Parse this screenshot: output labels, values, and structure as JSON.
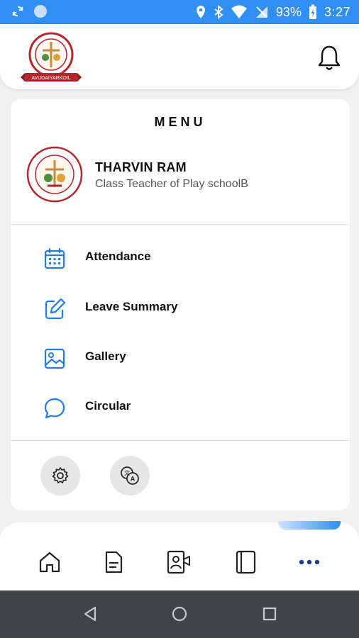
{
  "status_bar": {
    "battery": "93%",
    "time": "3:27"
  },
  "header": {
    "logo": {
      "ribbon_text": "AVUDAIYARKOIL",
      "ring_text": "ST. JOSEPH'S MATRIC HR SEC SCHOOL"
    }
  },
  "menu": {
    "title": "MENU",
    "profile": {
      "name": "THARVIN RAM",
      "role": "Class Teacher of Play schoolB",
      "logo_ring_text": "ST. JOSEPH'S MATRIC HR SEC SCHOOL",
      "logo_bottom_text": "AVUDAIYARKOIL"
    },
    "items": [
      {
        "label": "Attendance",
        "icon": "calendar-icon"
      },
      {
        "label": "Leave Summary",
        "icon": "edit-icon"
      },
      {
        "label": "Gallery",
        "icon": "image-icon"
      },
      {
        "label": "Circular",
        "icon": "chat-bubble-icon"
      }
    ],
    "quick_actions": [
      {
        "icon": "settings-icon"
      },
      {
        "icon": "translate-icon"
      }
    ]
  },
  "bottom_nav": {
    "items": [
      {
        "icon": "home-icon"
      },
      {
        "icon": "document-icon"
      },
      {
        "icon": "video-contact-icon"
      },
      {
        "icon": "notebook-icon"
      },
      {
        "icon": "more-icon",
        "active": true
      }
    ]
  },
  "colors": {
    "accent": "#2f8ff2",
    "icon_blue": "#1e7be8",
    "logo_red": "#b3262d"
  }
}
